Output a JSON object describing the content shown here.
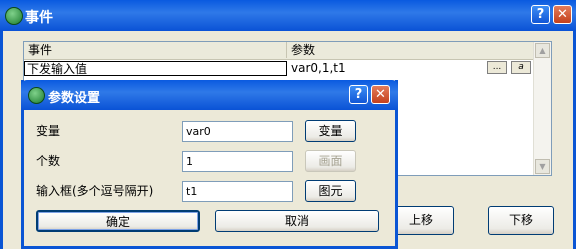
{
  "window": {
    "title": "事件",
    "help_label": "?",
    "close_label": "✕"
  },
  "list": {
    "columns": [
      "事件",
      "参数"
    ],
    "rows": [
      {
        "event": "下发输入值",
        "params": "var0,1,t1"
      }
    ],
    "ellipsis_label": "...",
    "font_label": "a"
  },
  "buttons": {
    "move_up": "上移",
    "move_down": "下移"
  },
  "dialog": {
    "title": "参数设置",
    "help_label": "?",
    "close_label": "✕",
    "fields": [
      {
        "label": "变量",
        "value": "var0",
        "button": "变量"
      },
      {
        "label": "个数",
        "value": "1",
        "button": "画面"
      },
      {
        "label": "输入框(多个逗号隔开)",
        "value": "t1",
        "button": "图元"
      }
    ],
    "ok": "确定",
    "cancel": "取消"
  }
}
